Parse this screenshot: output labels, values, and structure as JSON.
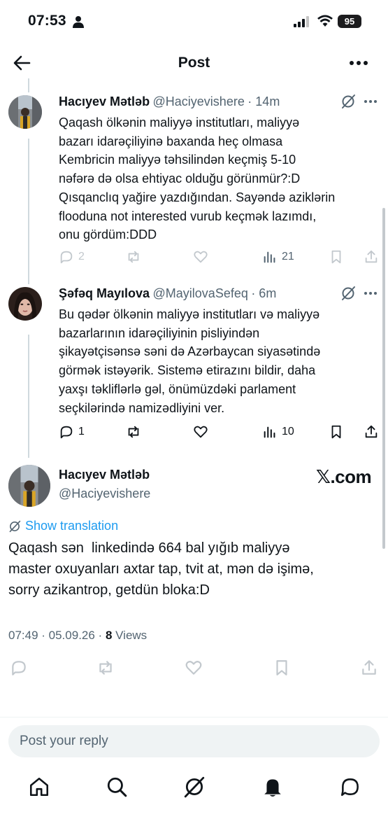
{
  "status_bar": {
    "time": "07:53",
    "battery": "95"
  },
  "header": {
    "title": "Post"
  },
  "tweets": [
    {
      "name": "Hacıyev Mətləb",
      "handle": "@Haciyevishere",
      "time": "· 14m",
      "lines": [
        "Qaqash ölkənin maliyyə institutları, maliyyə",
        "bazarı idarəçiliyinə baxanda heç olmasa",
        "Kembricin maliyyə təhsilindən keçmiş 5-10",
        "nəfərə də olsa ehtiyac olduğu görünmür?:D",
        "Qısqanclıq yağire yazdığından. Sayəndə aziklərin",
        "flooduna not interested vurub keçmək lazımdı,",
        "onu gördüm:DDD"
      ],
      "replies": "2",
      "views": "21"
    },
    {
      "name": "Şəfəq Mayılova",
      "handle": "@MayilovaSefeq",
      "time": "· 6m",
      "lines": [
        "Bu qədər ölkənin maliyyə institutları və maliyyə",
        "bazarlarının idarəçiliyinin pisliyindən",
        "şikayətçisənsə səni də Azərbaycan siyasətində",
        "görmək istəyərik. Sistemə etirazını bildir, daha",
        "yaxşı təkliflərlə gəl, önümüzdəki parlament",
        "seçkilərində namizədliyini ver."
      ],
      "replies": "1",
      "views": "10"
    }
  ],
  "main_post": {
    "name": "Hacıyev Mətləb",
    "handle": "@Haciyevishere",
    "watermark": "𝕏.com",
    "translate": "Show translation",
    "lines": [
      "Qaqash sən  linkedində 664 bal yığıb maliyyə",
      "master oxuyanları axtar tap, tvit at, mən də işimə,",
      "sorry azikantrop, getdün bloka:D"
    ],
    "datetime": "07:49 · 05.09.26 · ",
    "views_count": "8",
    "views_label": " Views"
  },
  "reply_box": {
    "placeholder": "Post your reply"
  },
  "colors": {
    "text": "#0f1419",
    "muted": "#536471",
    "link": "#1d9bf0",
    "line": "#cfd9de"
  }
}
